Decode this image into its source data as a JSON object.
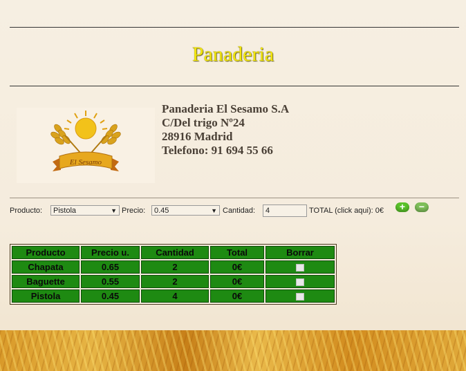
{
  "header": {
    "title": "Panaderia"
  },
  "company": {
    "name": "Panaderia El Sesamo S.A",
    "street": "C/Del trigo Nº24",
    "city": "28916 Madrid",
    "phone": "Telefono: 91 694 55 66",
    "logo_text": "El Sesamo"
  },
  "form": {
    "producto_label": "Producto:",
    "producto_value": "Pistola",
    "precio_label": "Precio:",
    "precio_value": "0.45",
    "cantidad_label": "Cantidad:",
    "cantidad_value": "4",
    "total_label": "TOTAL (click aqui): 0€",
    "add_icon": "plus-icon",
    "remove_icon": "minus-icon"
  },
  "table": {
    "headers": [
      "Producto",
      "Precio u.",
      "Cantidad",
      "Total",
      "Borrar"
    ],
    "rows": [
      {
        "producto": "Chapata",
        "precio": "0.65",
        "cantidad": "2",
        "total": "0€"
      },
      {
        "producto": "Baguette",
        "precio": "0.55",
        "cantidad": "2",
        "total": "0€"
      },
      {
        "producto": "Pistola",
        "precio": "0.45",
        "cantidad": "4",
        "total": "0€"
      }
    ]
  },
  "colors": {
    "title": "#f3e60a",
    "table_cell": "#1e8a12",
    "button_add": "#5ac22a"
  }
}
